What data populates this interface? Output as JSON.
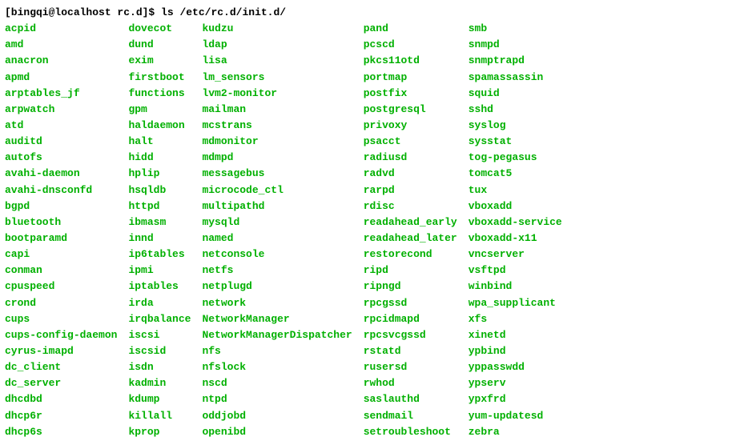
{
  "prompt": "[bingqi@localhost rc.d]$ ",
  "command": "ls /etc/rc.d/init.d/",
  "columns": [
    [
      "acpid",
      "amd",
      "anacron",
      "apmd",
      "arptables_jf",
      "arpwatch",
      "atd",
      "auditd",
      "autofs",
      "avahi-daemon",
      "avahi-dnsconfd",
      "bgpd",
      "bluetooth",
      "bootparamd",
      "capi",
      "conman",
      "cpuspeed",
      "crond",
      "cups",
      "cups-config-daemon",
      "cyrus-imapd",
      "dc_client",
      "dc_server",
      "dhcdbd",
      "dhcp6r",
      "dhcp6s"
    ],
    [
      "dovecot",
      "dund",
      "exim",
      "firstboot",
      "functions",
      "gpm",
      "haldaemon",
      "halt",
      "hidd",
      "hplip",
      "hsqldb",
      "httpd",
      "ibmasm",
      "innd",
      "ip6tables",
      "ipmi",
      "iptables",
      "irda",
      "irqbalance",
      "iscsi",
      "iscsid",
      "isdn",
      "kadmin",
      "kdump",
      "killall",
      "kprop"
    ],
    [
      "kudzu",
      "ldap",
      "lisa",
      "lm_sensors",
      "lvm2-monitor",
      "mailman",
      "mcstrans",
      "mdmonitor",
      "mdmpd",
      "messagebus",
      "microcode_ctl",
      "multipathd",
      "mysqld",
      "named",
      "netconsole",
      "netfs",
      "netplugd",
      "network",
      "NetworkManager",
      "NetworkManagerDispatcher",
      "nfs",
      "nfslock",
      "nscd",
      "ntpd",
      "oddjobd",
      "openibd"
    ],
    [
      "pand",
      "pcscd",
      "pkcs11otd",
      "portmap",
      "postfix",
      "postgresql",
      "privoxy",
      "psacct",
      "radiusd",
      "radvd",
      "rarpd",
      "rdisc",
      "readahead_early",
      "readahead_later",
      "restorecond",
      "ripd",
      "ripngd",
      "rpcgssd",
      "rpcidmapd",
      "rpcsvcgssd",
      "rstatd",
      "rusersd",
      "rwhod",
      "saslauthd",
      "sendmail",
      "setroubleshoot"
    ],
    [
      "smb",
      "snmpd",
      "snmptrapd",
      "spamassassin",
      "squid",
      "sshd",
      "syslog",
      "sysstat",
      "tog-pegasus",
      "tomcat5",
      "tux",
      "vboxadd",
      "vboxadd-service",
      "vboxadd-x11",
      "vncserver",
      "vsftpd",
      "winbind",
      "wpa_supplicant",
      "xfs",
      "xinetd",
      "ypbind",
      "yppasswdd",
      "ypserv",
      "ypxfrd",
      "yum-updatesd",
      "zebra"
    ]
  ]
}
